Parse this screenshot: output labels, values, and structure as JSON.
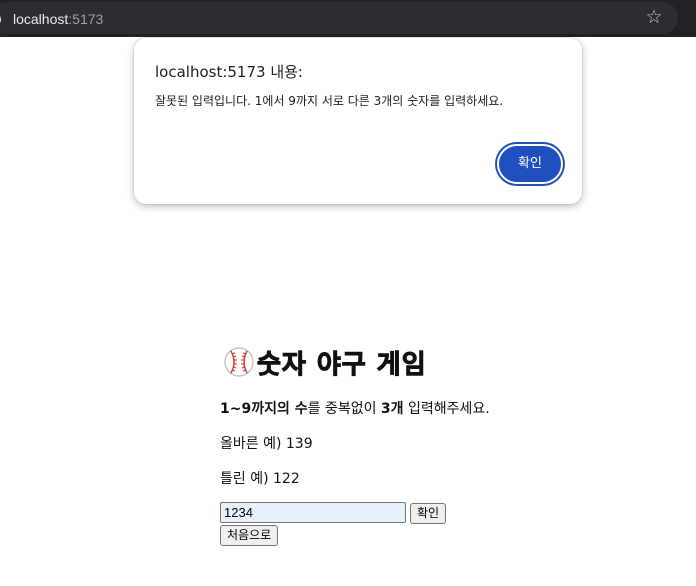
{
  "browser": {
    "url_host": "localhost",
    "url_port": ":5173"
  },
  "dialog": {
    "title": "localhost:5173 내용:",
    "message": "잘못된 입력입니다. 1에서 9까지 서로 다른 3개의 숫자를 입력하세요.",
    "ok_label": "확인"
  },
  "game": {
    "title": "숫자 야구 게임",
    "desc_part1": "1~9까지의 수",
    "desc_part2": "를 중복없이 ",
    "desc_part3": "3개",
    "desc_part4": " 입력해주세요.",
    "correct_example": "올바른 예) 139",
    "wrong_example": "틀린 예) 122",
    "input_value": "1234",
    "confirm_label": "확인",
    "restart_label": "처음으로"
  },
  "icons": {
    "title_icon": "baseball-icon",
    "info": "info-icon",
    "bookmark": "star-icon"
  },
  "colors": {
    "dialog_button": "#2050c0",
    "input_bg": "#e8f0fe",
    "topbar": "#202124"
  }
}
